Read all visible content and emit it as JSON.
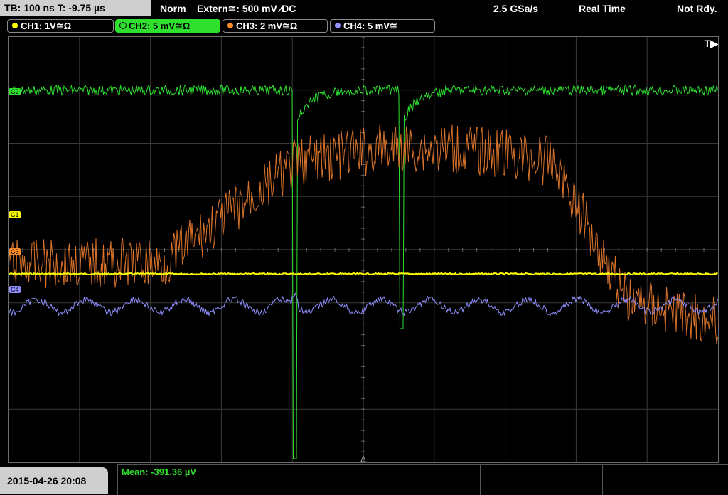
{
  "topbar": {
    "timebase": "TB: 100 ns   T: -9.75 µs",
    "mode": "Norm",
    "trigger": "Extern≅: 500 mV ⁄DC",
    "sample_rate": "2.5 GSa/s",
    "acq_mode": "Real Time",
    "status": "Not Rdy."
  },
  "channels": [
    {
      "label": "CH1: 1V≅Ω",
      "color": "#ffff00"
    },
    {
      "label": "CH2: 5 mV≅Ω",
      "color": "#2fe02f"
    },
    {
      "label": "CH3: 2 mV≅Ω",
      "color": "#ff8c2a"
    },
    {
      "label": "CH4: 5 mV≅",
      "color": "#8f8fff"
    }
  ],
  "markers": {
    "trigger_marker": "T▶",
    "c1": "C1",
    "c2": "C2",
    "c3": "C3",
    "c4": "C4"
  },
  "colors": {
    "ch1": "#ffff00",
    "ch2": "#2fe02f",
    "ch3": "#d9732a",
    "ch4": "#8f8fff",
    "grid": "#3a3a3a"
  },
  "footer": {
    "datetime": "2015-04-26 20:08",
    "measurement": "Mean: -391.36 µV"
  }
}
